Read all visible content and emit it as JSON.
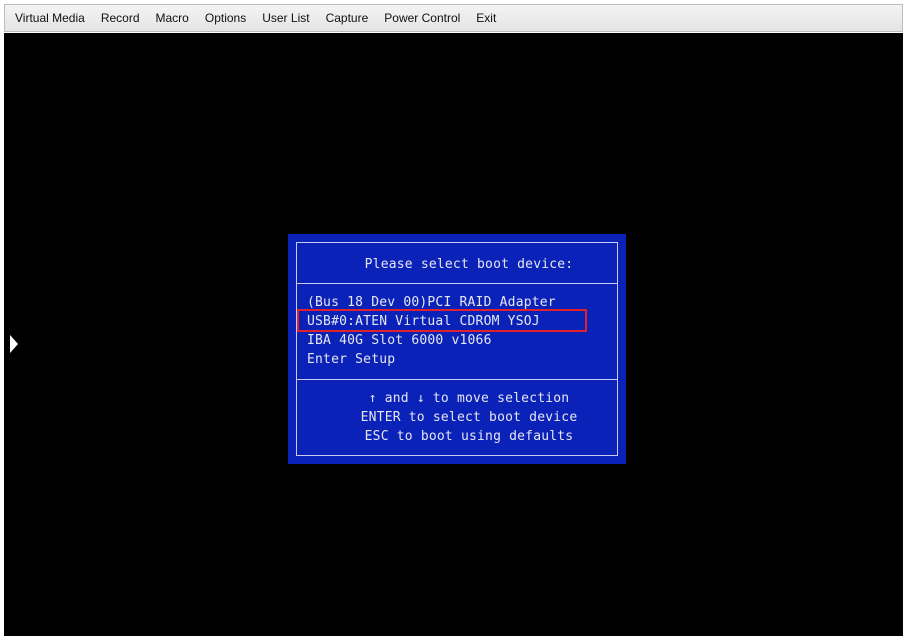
{
  "menubar": {
    "items": [
      {
        "label": "Virtual Media"
      },
      {
        "label": "Record"
      },
      {
        "label": "Macro"
      },
      {
        "label": "Options"
      },
      {
        "label": "User List"
      },
      {
        "label": "Capture"
      },
      {
        "label": "Power Control"
      },
      {
        "label": "Exit"
      }
    ]
  },
  "boot_menu": {
    "title": "Please select boot device:",
    "devices": [
      {
        "label": "(Bus 18 Dev 00)PCI RAID Adapter"
      },
      {
        "label": "USB#0:ATEN Virtual CDROM YSOJ",
        "highlighted": true
      },
      {
        "label": "IBA 40G Slot 6000 v1066"
      },
      {
        "label": "Enter Setup"
      }
    ],
    "help": [
      "↑ and ↓ to move selection",
      "ENTER to select boot device",
      "ESC to boot using defaults"
    ]
  },
  "colors": {
    "dialog_background": "#0b22b8",
    "screen_background": "#000000",
    "highlight_border": "#e0202a"
  },
  "icons": {
    "side_handle": "triangle-right-icon"
  }
}
